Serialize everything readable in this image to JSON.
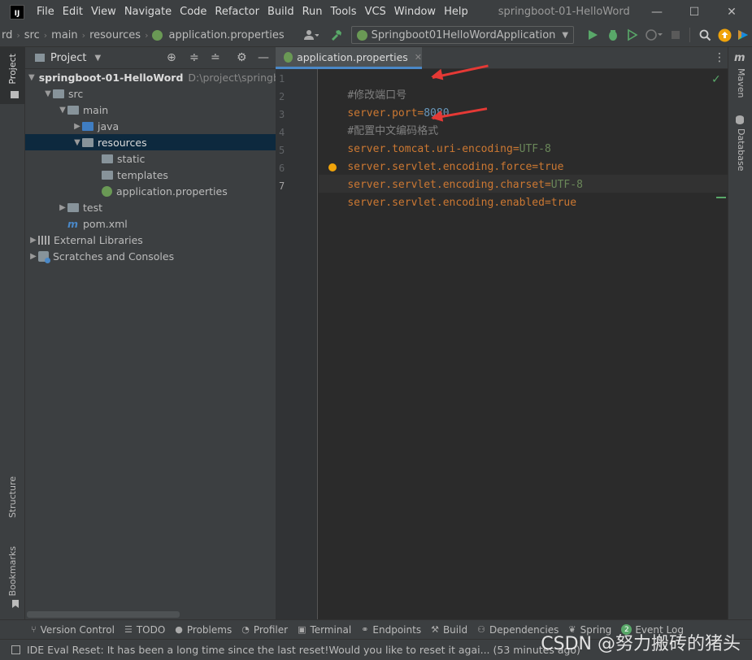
{
  "window": {
    "title": "springboot-01-HelloWord",
    "logo": "IJ",
    "menu": [
      "File",
      "Edit",
      "View",
      "Navigate",
      "Code",
      "Refactor",
      "Build",
      "Run",
      "Tools",
      "VCS",
      "Window",
      "Help"
    ],
    "minimize": "—",
    "maximize": "☐",
    "close": "✕"
  },
  "navbar": {
    "breadcrumbs": [
      "rd",
      "src",
      "main",
      "resources",
      "application.properties"
    ],
    "run_config": "Springboot01HelloWordApplication"
  },
  "left_strip": {
    "project": "Project",
    "structure": "Structure",
    "bookmarks": "Bookmarks"
  },
  "right_strip": {
    "maven": "Maven",
    "database": "Database"
  },
  "project_panel": {
    "title": "Project",
    "tree": [
      {
        "label": "springboot-01-HelloWord",
        "path": "D:\\project\\springb"
      },
      {
        "label": "src"
      },
      {
        "label": "main"
      },
      {
        "label": "java"
      },
      {
        "label": "resources"
      },
      {
        "label": "static"
      },
      {
        "label": "templates"
      },
      {
        "label": "application.properties"
      },
      {
        "label": "test"
      },
      {
        "label": "pom.xml"
      },
      {
        "label": "External Libraries"
      },
      {
        "label": "Scratches and Consoles"
      }
    ]
  },
  "editor": {
    "tab_label": "application.properties",
    "lines": [
      {
        "num": "1",
        "comment": "#修改端口号"
      },
      {
        "num": "2",
        "key": "server.port",
        "value": "8080"
      },
      {
        "num": "3",
        "comment": "#配置中文编码格式"
      },
      {
        "num": "4",
        "key": "server.tomcat.uri-encoding",
        "value": "UTF-8"
      },
      {
        "num": "5",
        "key": "server.servlet.encoding.force",
        "value": "true"
      },
      {
        "num": "6",
        "key": "server.servlet.encoding.charset",
        "value": "UTF-8"
      },
      {
        "num": "7",
        "key": "server.servlet.encoding.enabled",
        "value": "true"
      }
    ],
    "eq": "="
  },
  "bottom_tabs": [
    "Version Control",
    "TODO",
    "Problems",
    "Profiler",
    "Terminal",
    "Endpoints",
    "Build",
    "Dependencies",
    "Spring",
    "Event Log"
  ],
  "event_log_count": "2",
  "status_message": "IDE Eval Reset: It has been a long time since the last reset!Would you like to reset it agai... (53 minutes ago)",
  "watermark": "CSDN @努力搬砖的猪头",
  "colors": {
    "accent": "#4a88c7",
    "selection": "#0d293e",
    "arrow": "#e53935"
  }
}
